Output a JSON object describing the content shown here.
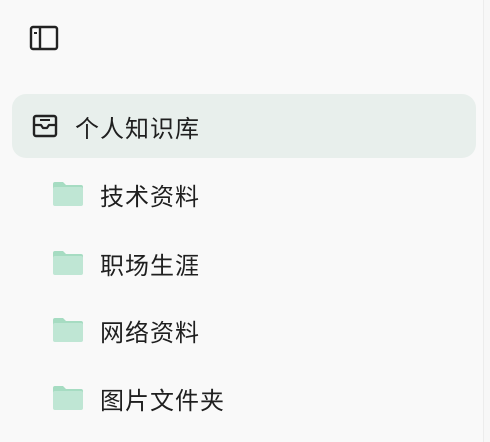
{
  "sidebar": {
    "toggle_icon": "sidebar-toggle-icon",
    "knowledge_base": {
      "label": "个人知识库",
      "icon": "knowledge-base-icon",
      "selected": true
    },
    "folders": [
      {
        "label": "技术资料",
        "icon": "folder-icon"
      },
      {
        "label": "职场生涯",
        "icon": "folder-icon"
      },
      {
        "label": "网络资料",
        "icon": "folder-icon"
      },
      {
        "label": "图片文件夹",
        "icon": "folder-icon"
      }
    ]
  },
  "colors": {
    "background": "#f9f9f9",
    "selected_bg": "#e8efec",
    "folder_fill": "#bfe6d4",
    "folder_tab": "#a6dcc2",
    "text": "#1f1f1f"
  }
}
